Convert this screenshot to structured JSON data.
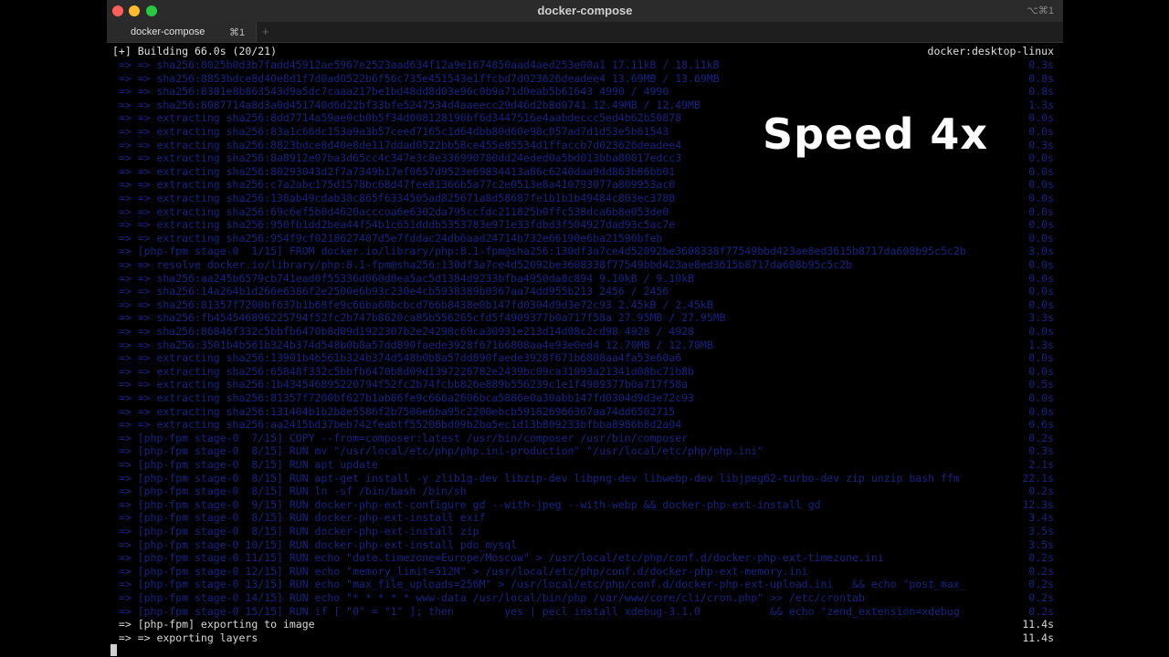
{
  "window": {
    "title": "docker-compose",
    "right_shortcut": "⌥⌘1"
  },
  "tabs": [
    {
      "label": "docker-compose",
      "shortcut": "⌘1"
    }
  ],
  "tab_add": "+",
  "header": {
    "status": "[+] Building 66.0s (20/21)",
    "context": "docker:desktop-linux"
  },
  "overlay": {
    "text": "Speed 4x"
  },
  "lines": [
    {
      "text": " => => sha256:8025b0d3b7fadd45912ae5967e2523aad634f12a9e1674850aad4aed253e00a1 17.11kB / 18.11kB",
      "time": "0.3s",
      "faded": true
    },
    {
      "text": " => => sha256:8853bdce8d40e8d1f7d0ad0522b6f56c735e451543e1ffcbd7d023626deadee4 13.69MB / 13.69MB",
      "time": "0.8s",
      "faded": true
    },
    {
      "text": " => => sha256:8381e8b863543d9a5dc7caaa217be1bd48dd8d03e96c0b9a71d0eab5b61643 4990 / 4990",
      "time": "0.8s",
      "faded": true
    },
    {
      "text": " => => sha256:8087714a8d3a0d451740d6d22bf33bfe5247534d4aaeecc29d46d2b8d0741 12.49MB / 12.49MB",
      "time": "1.3s",
      "faded": true
    },
    {
      "text": " => => extracting sha256:8dd7714a59ae0cb0b5f34d008128190bf6d3447516e4aabdeccc5ed4b62b50878",
      "time": "0.0s",
      "faded": true
    },
    {
      "text": " => => extracting sha256:83a1c66dc153a9a3b57ceed7165c1d64dbb80d60e98c057ad7d1d53e5b61543",
      "time": "0.0s",
      "faded": true
    },
    {
      "text": " => => extracting sha256:8823bdce8d40e8de117ddad0522bb58ce455e85534d1ffaccb7d023626deadee4",
      "time": "0.3s",
      "faded": true
    },
    {
      "text": " => => extracting sha256:8a8912e07ba3d65cc4c347e3c8e336990780dd24eded0a5bd013bba80017edcc3",
      "time": "0.0s",
      "faded": true
    },
    {
      "text": " => => extracting sha256:80293043d2f7a7349b17ef0657d9523e69834413a86c6240daa9dd863b86bb01",
      "time": "0.0s",
      "faded": true
    },
    {
      "text": " => => extracting sha256:c7a2abc175d1578bc68d47fee81366b5a77c2e0513e8a410793077a809953ac0",
      "time": "0.0s",
      "faded": true
    },
    {
      "text": " => => extracting sha256:138ab49cdab38c865f6334505ad825671a8d58687fe1b1b1b49484c803ec3788",
      "time": "0.0s",
      "faded": true
    },
    {
      "text": " => => extracting sha256:69c6ef5b0d4620acccoa6e6302da795ccfdc211825b0ffc538dca6b8e053de0",
      "time": "0.0s",
      "faded": true
    },
    {
      "text": " => => extracting sha256:950fb1dd2bea44f54b1c651dddb5353783e971e33fdbd3f504927dad93c5ac7e",
      "time": "0.0s",
      "faded": true
    },
    {
      "text": " => => extracting sha256:954f9cf0218627407d5e7fddac24db6aad24714b732e66190e6ba21590bfeb",
      "time": "0.0s",
      "faded": true
    },
    {
      "text": " => [php-fpm stage-0  1/15] FROM docker.io/library/php:8.1-fpm@sha256:130df3a7ce4d52092be3608338f77549bbd423ae8ed3615b8717da608b95c5c2b",
      "time": "3.0s",
      "faded": true
    },
    {
      "text": " => => resolve docker.io/library/php:8.1-fpm@sha256:130df3a7ce4d52092be3608338f77549bbd423ae8ed3615b8717da608b95c5c2b",
      "time": "0.0s",
      "faded": true
    },
    {
      "text": " => => sha256:aa245b6579cb741ead0f55336d060d8ea5ac5d1384d9233bfba4950da8c894 9.10kB / 9.10kB",
      "time": "0.0s",
      "faded": true
    },
    {
      "text": " => => sha256:14a264b1d266e6386f2e2500e6b93c230e4cb5938389b0367aa74dd955b213 2456 / 2456",
      "time": "0.0s",
      "faded": true
    },
    {
      "text": " => => sha256:81357f7200bf637b1b68fe9c66ba60bcbcd766b8438e0b147fd0304d9d3e72c93 2.45kB / 2.45kB",
      "time": "0.0s",
      "faded": true
    },
    {
      "text": " => => sha256:fb454546896225794f52fc2b747b8620ca85b556265cfd5f4909377b0a717f58a 27.95MB / 27.95MB",
      "time": "3.3s",
      "faded": true
    },
    {
      "text": " => => sha256:86846f332c5bbfb6470b8d09d1922307b2e24298c69ca30931e213d14d08c2cd98 4928 / 4928",
      "time": "0.0s",
      "faded": true
    },
    {
      "text": " => => sha256:3501b4b561b324b374d548b0b8a57dd890faede3928f671b6808aa4e93e0ed4 12.70MB / 12.70MB",
      "time": "1.3s",
      "faded": true
    },
    {
      "text": " => => extracting sha256:13901b4b561b324b374d548b0b8a57dd890faede3928f671b6808aa4fa53e60a6",
      "time": "0.0s",
      "faded": true
    },
    {
      "text": " => => extracting sha256:65848f332c5bbfb6470b8d09d1397226782e2439bc09ca31093a21341d08bc71b8b",
      "time": "0.0s",
      "faded": true
    },
    {
      "text": " => => extracting sha256:1b434546895220794f52fc2b74fcbb826e889b556239c1e1f4909377b0a717f58a",
      "time": "0.5s",
      "faded": true
    },
    {
      "text": " => => extracting sha256:81357f7200bf627b1ab86fe9c666a2606bca5886e0a30abb147fd0304d9d3e72c93",
      "time": "0.0s",
      "faded": true
    },
    {
      "text": " => => extracting sha256:131404b1b2b8e5586f2b7500e6ba95c2200ebcb591826966367aa74dd6502715",
      "time": "0.0s",
      "faded": true
    },
    {
      "text": " => => extracting sha256:aa2415bd37beb742feabtf55208bd09b2ba5ec1d13b809233bfbba8986b8d2a04",
      "time": "0.6s",
      "faded": true
    },
    {
      "text": " => [php-fpm stage-0  7/15] COPY --from=composer:latest /usr/bin/composer /usr/bin/composer",
      "time": "0.2s",
      "faded": true
    },
    {
      "text": " => [php-fpm stage-0  8/15] RUN mv \"/usr/local/etc/php/php.ini-production\" \"/usr/local/etc/php/php.ini\"",
      "time": "0.3s",
      "faded": true
    },
    {
      "text": " => [php-fpm stage-0  8/15] RUN apt update",
      "time": "2.1s",
      "faded": true
    },
    {
      "text": " => [php-fpm stage-0  8/15] RUN apt-get install -y zlib1g-dev libzip-dev libpng-dev libwebp-dev libjpeg62-turbo-dev zip unzip bash ffm",
      "time": "22.1s",
      "faded": true
    },
    {
      "text": " => [php-fpm stage-0  8/15] RUN ln -sf /bin/bash /bin/sh",
      "time": "0.2s",
      "faded": true
    },
    {
      "text": " => [php-fpm stage-0  9/15] RUN docker-php-ext-configure gd --with-jpeg --with-webp && docker-php-ext-install gd",
      "time": "12.3s",
      "faded": true
    },
    {
      "text": " => [php-fpm stage-0  8/15] RUN docker-php-ext-install exif",
      "time": "3.4s",
      "faded": true
    },
    {
      "text": " => [php-fpm stage-0  8/15] RUN docker-php-ext-install zip",
      "time": "3.5s",
      "faded": true
    },
    {
      "text": " => [php-fpm stage-0 10/15] RUN docker-php-ext-install pdo_mysql",
      "time": "3.5s",
      "faded": true
    },
    {
      "text": " => [php-fpm stage-0 11/15] RUN echo \"date.timezone=Europe/Moscow\" > /usr/local/etc/php/conf.d/docker-php-ext-timezone.ini",
      "time": "0.2s",
      "faded": true
    },
    {
      "text": " => [php-fpm stage-0 12/15] RUN echo \"memory_limit=512M\" > /usr/local/etc/php/conf.d/docker-php-ext-memory.ini",
      "time": "0.2s",
      "faded": true
    },
    {
      "text": " => [php-fpm stage-0 13/15] RUN echo \"max_file_uploads=256M\" > /usr/local/etc/php/conf.d/docker-php-ext-upload.ini   && echo \"post_max_",
      "time": "0.2s",
      "faded": true
    },
    {
      "text": " => [php-fpm stage-0 14/15] RUN echo \"* * * * * www-data /usr/local/bin/php /var/www/core/cli/cron.php\" >> /etc/crontab",
      "time": "0.2s",
      "faded": true
    },
    {
      "text": " => [php-fpm stage-0 15/15] RUN if [ \"0\" = \"1\" ]; then        yes | pecl install xdebug-3.1.0           && echo \"zend_extension=xdebug",
      "time": "0.2s",
      "faded": true
    },
    {
      "text": " => [php-fpm] exporting to image",
      "time": "11.4s",
      "faded": false
    },
    {
      "text": " => => exporting layers",
      "time": "11.4s",
      "faded": false
    }
  ]
}
